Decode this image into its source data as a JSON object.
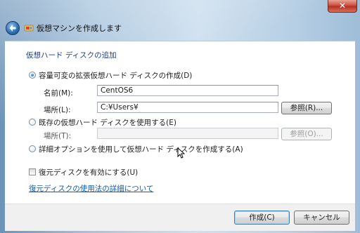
{
  "window": {
    "title": "仮想マシンを作成します",
    "close_glyph": "✕",
    "icons": {
      "back": "back-arrow-icon",
      "wizard": "vm-wizard-icon",
      "close": "close-icon"
    }
  },
  "section": {
    "title": "仮想ハード ディスクの追加"
  },
  "options": {
    "create_new": {
      "label": "容量可変の拡張仮想ハード ディスクの作成(D)",
      "selected": true,
      "name_label": "名前(M):",
      "name_value": "CentOS6",
      "location_label": "場所(L):",
      "location_value": "C:¥Users¥",
      "browse_label": "参照(R)..."
    },
    "use_existing": {
      "label": "既存の仮想ハード ディスクを使用する(E)",
      "selected": false,
      "location_label": "場所(T):",
      "location_value": "",
      "browse_label": "参照(O)..."
    },
    "advanced": {
      "label": "詳細オプションを使用して仮想ハード ディスクを作成する(A)",
      "selected": false
    }
  },
  "restore": {
    "checkbox_label": "復元ディスクを有効にする(U)",
    "checked": false,
    "link_text": "復元ディスクの使用法の詳細について"
  },
  "footer": {
    "create_label": "作成(C)",
    "cancel_label": "キャンセル"
  }
}
